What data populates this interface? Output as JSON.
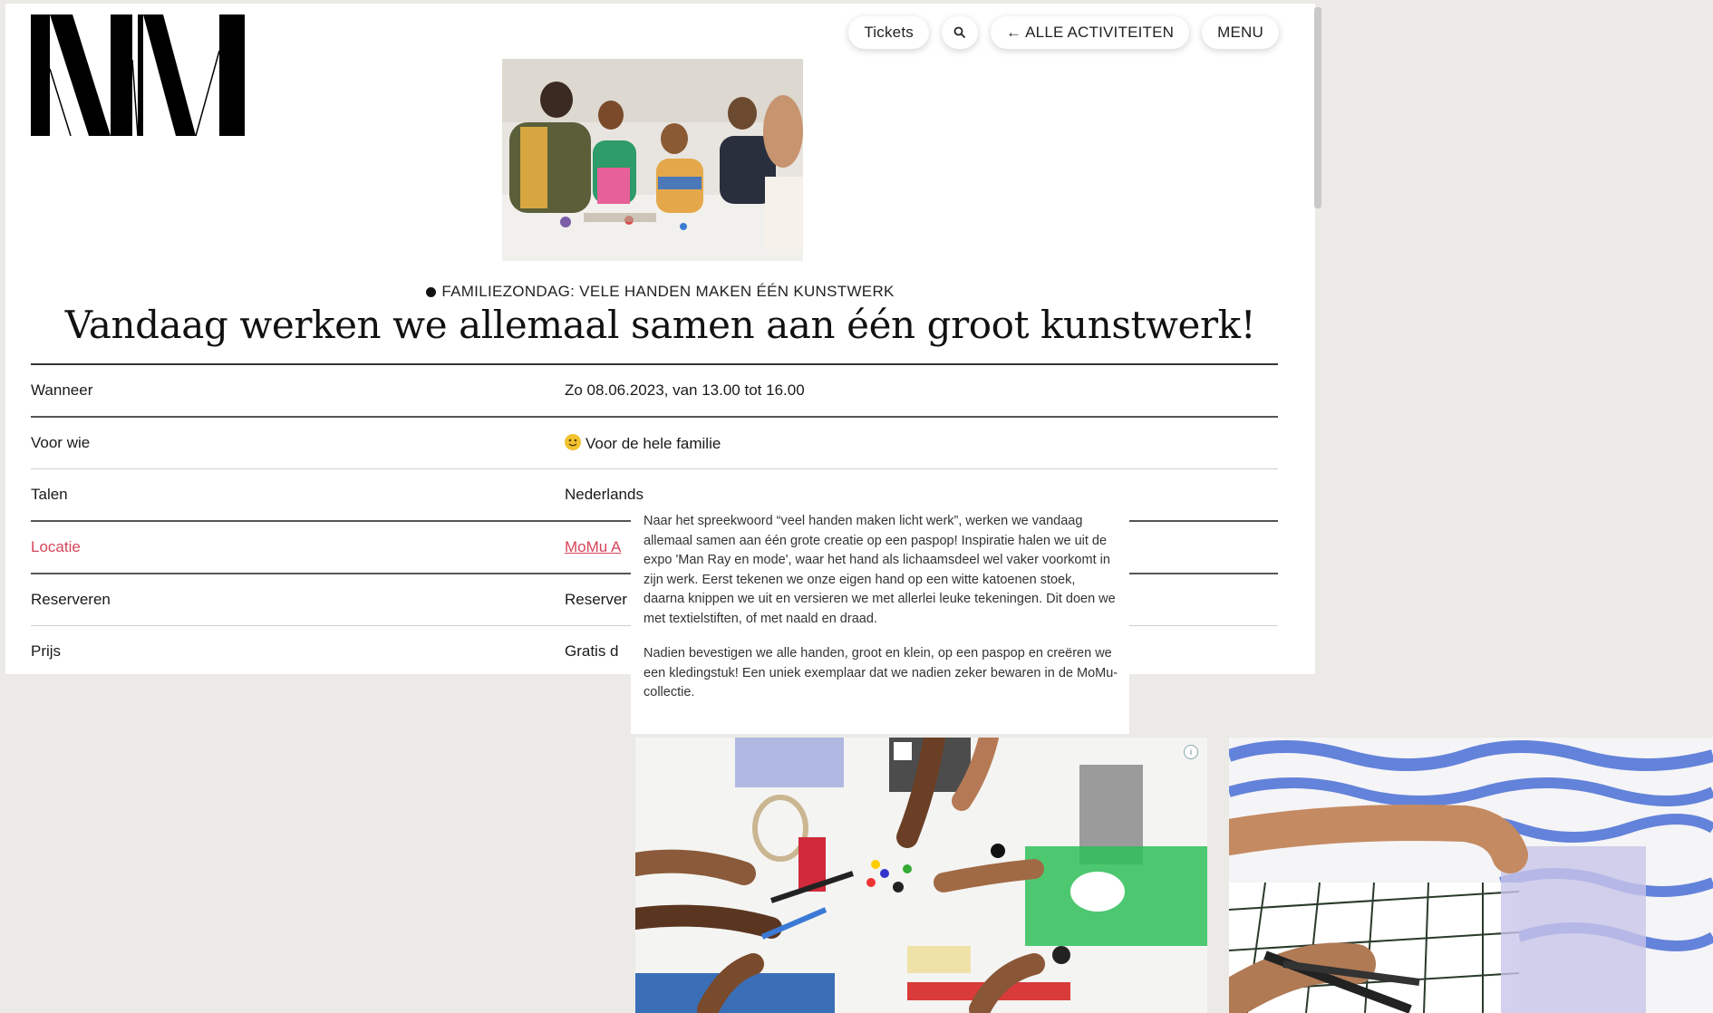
{
  "nav": {
    "tickets": "Tickets",
    "search_icon": "search-icon",
    "all_activities": "← ALLE ACTIVITEITEN",
    "menu": "MENU"
  },
  "event": {
    "category": "FAMILIEZONDAG: VELE HANDEN MAKEN ÉÉN KUNSTWERK",
    "title": "Vandaag werken we allemaal samen aan één groot kunstwerk!"
  },
  "info_rows": [
    {
      "label": "Wanneer",
      "value": "Zo 08.06.2023, van 13.00 tot 16.00"
    },
    {
      "label": "Voor wie",
      "value": "Voor de hele familie"
    },
    {
      "label": "Talen",
      "value": "Nederlands"
    },
    {
      "label": "Locatie",
      "value": "MoMu A"
    },
    {
      "label": "Reserveren",
      "value": "Reserver"
    },
    {
      "label": "Prijs",
      "value": "Gratis d"
    }
  ],
  "description": {
    "p1": "Naar het spreekwoord “veel handen maken licht werk”, werken we vandaag allemaal samen aan één grote creatie op een paspop! Inspiratie halen we uit de expo 'Man Ray en mode', waar het hand als lichaamsdeel wel vaker voorkomt in zijn werk. Eerst tekenen we onze eigen hand op een witte katoenen stoek, daarna knippen we uit en versieren we met allerlei leuke tekeningen. Dit doen we met textielstiften, of met naald en draad.",
    "p2": "Nadien bevestigen we alle handen, groot en klein, op een paspop en creëren we een kledingstuk! Een uniek exemplaar dat we nadien zeker bewaren in de MoMu-collectie."
  },
  "colors": {
    "accent_red": "#d6455b",
    "background": "#ebeae6"
  }
}
